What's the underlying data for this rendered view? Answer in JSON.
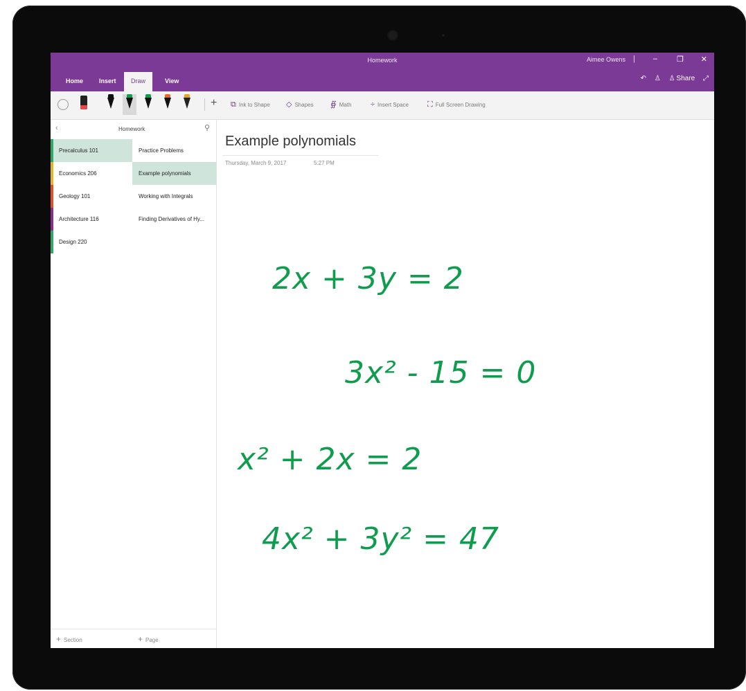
{
  "app": {
    "title": "Homework",
    "user": "Aimee Owens",
    "window_controls": {
      "separator": "|",
      "minimize": "–",
      "restore": "❐",
      "close": "✕"
    },
    "tabs": [
      "Home",
      "Insert",
      "Draw",
      "View"
    ],
    "active_tab": "Draw",
    "share_label": "Share"
  },
  "toolbar": {
    "plus": "+",
    "buttons": [
      {
        "icon": "ink-to-shape-icon",
        "glyph": "⧉",
        "label": "Ink to Shape"
      },
      {
        "icon": "shapes-icon",
        "glyph": "◇",
        "label": "Shapes"
      },
      {
        "icon": "math-icon",
        "glyph": "∯",
        "label": "Math"
      },
      {
        "icon": "insert-space-icon",
        "glyph": "÷",
        "label": "Insert Space"
      },
      {
        "icon": "full-screen-icon",
        "glyph": "⛶",
        "label": "Full Screen Drawing"
      }
    ],
    "pen_colors": [
      "#111111",
      "#0e9c4d",
      "#111111",
      "#111111",
      "#e3a32a"
    ]
  },
  "nav": {
    "notebook": "Homework",
    "sections": [
      {
        "label": "Precalculus 101",
        "color": "#2fa86a",
        "active": true
      },
      {
        "label": "Economics 206",
        "color": "#e6b51c",
        "active": false
      },
      {
        "label": "Geology 101",
        "color": "#e0512b",
        "active": false
      },
      {
        "label": "Architecture 116",
        "color": "#8b2f8f",
        "active": false
      },
      {
        "label": "Design 220",
        "color": "#2fa86a",
        "active": false
      }
    ],
    "pages": [
      {
        "label": "Practice Problems",
        "active": false
      },
      {
        "label": "Example polynomials",
        "active": true
      },
      {
        "label": "Working with Integrals",
        "active": false
      },
      {
        "label": "Finding Derivatives of Hy...",
        "active": false
      }
    ],
    "add_section": "Section",
    "add_page": "Page",
    "plus": "+"
  },
  "page": {
    "title": "Example polynomials",
    "date": "Thursday, March 9, 2017",
    "time": "5:27 PM",
    "ink_color": "#0e9c4d",
    "equations": [
      "2x + 3y = 2",
      "3x² - 15 = 0",
      "x² + 2x = 2",
      "4x² + 3y² = 47"
    ]
  }
}
